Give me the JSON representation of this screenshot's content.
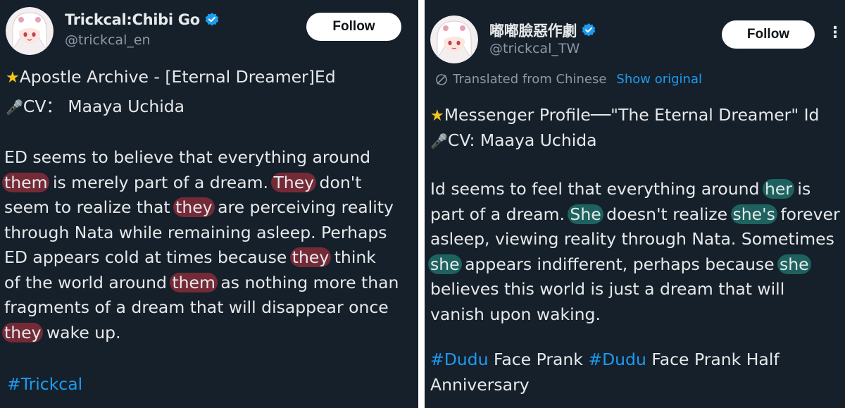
{
  "left": {
    "display_name": "Trickcal:Chibi Go",
    "handle": "@trickcal_en",
    "follow_label": "Follow",
    "title_line": "Apostle Archive - [Eternal Dreamer]Ed",
    "cv_line": "CV： Maaya Uchida",
    "paragraph": [
      [
        {
          "t": "ED seems to believe that everything around"
        }
      ],
      [
        {
          "t": "them",
          "hl": true
        },
        {
          "t": " is merely part of a dream. "
        },
        {
          "t": "They",
          "hl": true
        },
        {
          "t": " don't"
        }
      ],
      [
        {
          "t": "seem to realize that "
        },
        {
          "t": "they",
          "hl": true
        },
        {
          "t": " are perceiving reality"
        }
      ],
      [
        {
          "t": "through Nata while remaining asleep. Perhaps"
        }
      ],
      [
        {
          "t": "ED appears cold at times because "
        },
        {
          "t": "they",
          "hl": true
        },
        {
          "t": " think"
        }
      ],
      [
        {
          "t": "of the world around "
        },
        {
          "t": "them",
          "hl": true
        },
        {
          "t": " as nothing more than"
        }
      ],
      [
        {
          "t": "fragments of a dream that will disappear once"
        }
      ],
      [
        {
          "t": "they",
          "hl": true
        },
        {
          "t": " wake up."
        }
      ]
    ],
    "hashtag": "#Trickcal"
  },
  "right": {
    "display_name": "嘟嘟臉惡作劇",
    "handle": "@trickcal_TW",
    "follow_label": "Follow",
    "more_label": "⋮",
    "translated_label": "Translated from Chinese",
    "show_original_label": "Show original",
    "title_line": "Messenger Profile──\"The Eternal Dreamer\" Id",
    "cv_line": "CV: Maaya Uchida",
    "paragraph": [
      [
        {
          "t": "Id seems to feel that everything around "
        },
        {
          "t": "her",
          "hl": true
        },
        {
          "t": " is"
        }
      ],
      [
        {
          "t": "part of a dream. "
        },
        {
          "t": "She",
          "hl": true
        },
        {
          "t": " doesn't realize "
        },
        {
          "t": "she's",
          "hl": true
        },
        {
          "t": " forever"
        }
      ],
      [
        {
          "t": "asleep, viewing reality through Nata. Sometimes"
        }
      ],
      [
        {
          "t": "she",
          "hl": true
        },
        {
          "t": " appears indifferent, perhaps because "
        },
        {
          "t": "she",
          "hl": true
        }
      ],
      [
        {
          "t": "believes this world is just a dream that will"
        }
      ],
      [
        {
          "t": "vanish upon waking."
        }
      ]
    ],
    "hashtag_lines": [
      [
        {
          "t": "#Dudu",
          "tag": true
        },
        {
          "t": " Face Prank "
        },
        {
          "t": "#Dudu",
          "tag": true
        },
        {
          "t": " Face Prank Half"
        }
      ],
      [
        {
          "t": "Anniversary"
        }
      ]
    ]
  },
  "colors": {
    "background": "#15202b",
    "text": "#e7e9ea",
    "muted": "#8b98a5",
    "link": "#1d9bf0",
    "verified": "#1d9bf0",
    "highlight_left": "#962d3c",
    "highlight_right": "#1e6e69"
  },
  "icons": {
    "verified": "verified-badge-icon",
    "star": "star-emoji-icon",
    "mic": "microphone-emoji-icon",
    "translate": "translate-globe-icon",
    "more": "more-options-icon",
    "avatar": "chibi-girl-avatar"
  }
}
